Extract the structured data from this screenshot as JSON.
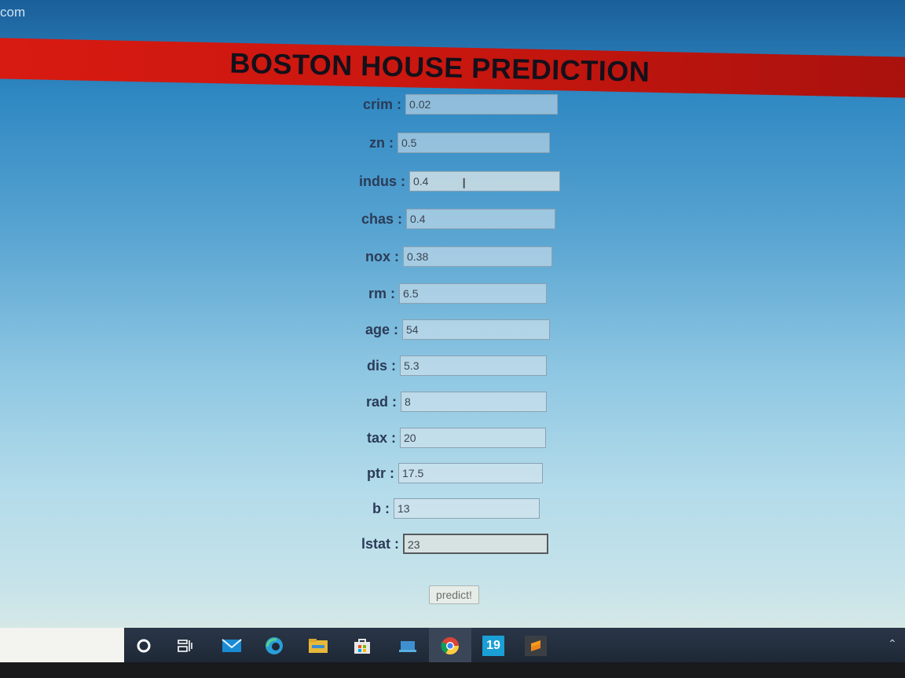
{
  "browser": {
    "url_fragment": "com"
  },
  "page": {
    "title": "BOSTON HOUSE PREDICTION"
  },
  "form": {
    "fields": [
      {
        "name": "crim",
        "label": "crim :",
        "value": "0.02"
      },
      {
        "name": "zn",
        "label": "zn :",
        "value": "0.5"
      },
      {
        "name": "indus",
        "label": "indus :",
        "value": "0.4"
      },
      {
        "name": "chas",
        "label": "chas :",
        "value": "0.4"
      },
      {
        "name": "nox",
        "label": "nox :",
        "value": "0.38"
      },
      {
        "name": "rm",
        "label": "rm :",
        "value": "6.5"
      },
      {
        "name": "age",
        "label": "age :",
        "value": "54"
      },
      {
        "name": "dis",
        "label": "dis :",
        "value": "5.3"
      },
      {
        "name": "rad",
        "label": "rad :",
        "value": "8"
      },
      {
        "name": "tax",
        "label": "tax :",
        "value": "20"
      },
      {
        "name": "ptr",
        "label": "ptr :",
        "value": "17.5"
      },
      {
        "name": "b",
        "label": "b :",
        "value": "13"
      },
      {
        "name": "lstat",
        "label": "lstat :",
        "value": "23"
      }
    ],
    "submit_label": "predict!"
  },
  "taskbar": {
    "icons": [
      "cortana-circle-icon",
      "task-view-icon",
      "mail-icon",
      "edge-icon",
      "file-explorer-icon",
      "store-icon",
      "network-app-icon",
      "chrome-icon",
      "app-19-icon",
      "sublime-text-icon"
    ],
    "badge_19": "19"
  },
  "colors": {
    "banner": "#d81a12",
    "title_text": "#15101a",
    "label_text": "#2b3b57"
  }
}
